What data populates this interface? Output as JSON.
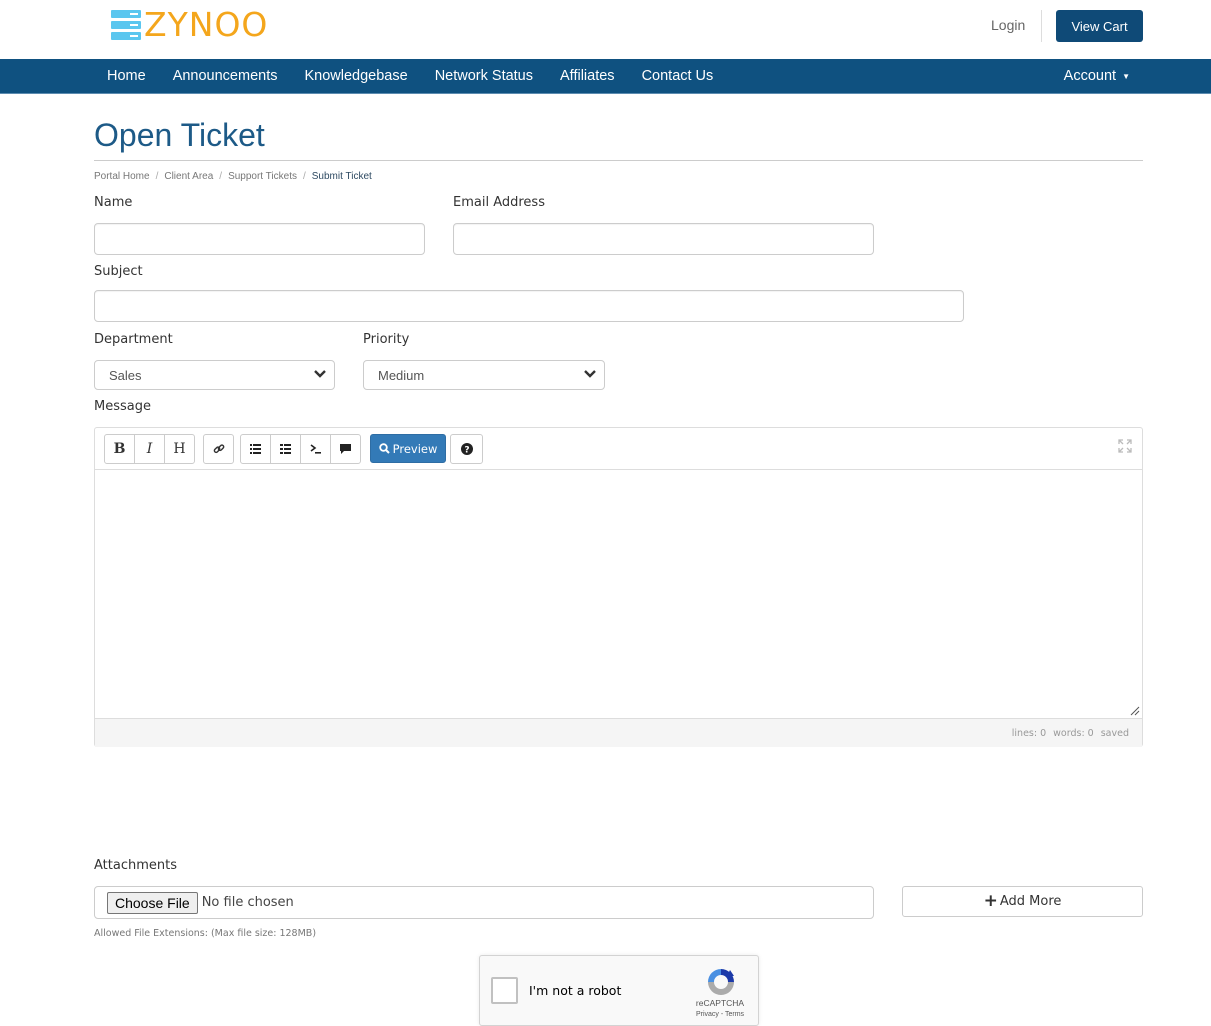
{
  "header": {
    "logo_text": "ZYNOO",
    "login_label": "Login",
    "view_cart_label": "View Cart"
  },
  "nav": {
    "items": [
      "Home",
      "Announcements",
      "Knowledgebase",
      "Network Status",
      "Affiliates",
      "Contact Us"
    ],
    "account_label": "Account",
    "bar_color": "#0f5180"
  },
  "page": {
    "title": "Open Ticket",
    "breadcrumb": [
      "Portal Home",
      "Client Area",
      "Support Tickets",
      "Submit Ticket"
    ],
    "breadcrumb_separator": "/"
  },
  "form": {
    "name_label": "Name",
    "name_value": "",
    "email_label": "Email Address",
    "email_value": "",
    "subject_label": "Subject",
    "subject_value": "",
    "department_label": "Department",
    "department_value": "Sales",
    "priority_label": "Priority",
    "priority_value": "Medium",
    "message_label": "Message",
    "message_value": ""
  },
  "editor": {
    "toolbar": {
      "bold": "B",
      "italic": "I",
      "heading": "H",
      "preview_label": "Preview"
    },
    "status": {
      "lines": "lines: 0",
      "words": "words: 0",
      "saved": "saved"
    },
    "accent_color": "#337ab7"
  },
  "attachments": {
    "label": "Attachments",
    "choose_file_label": "Choose File",
    "no_file_text": "No file chosen",
    "add_more_label": "Add More",
    "help_text": "Allowed File Extensions: (Max file size: 128MB)"
  },
  "captcha": {
    "label": "I'm not a robot",
    "brand": "reCAPTCHA",
    "privacy": "Privacy",
    "terms": "Terms",
    "links_separator": " - "
  }
}
